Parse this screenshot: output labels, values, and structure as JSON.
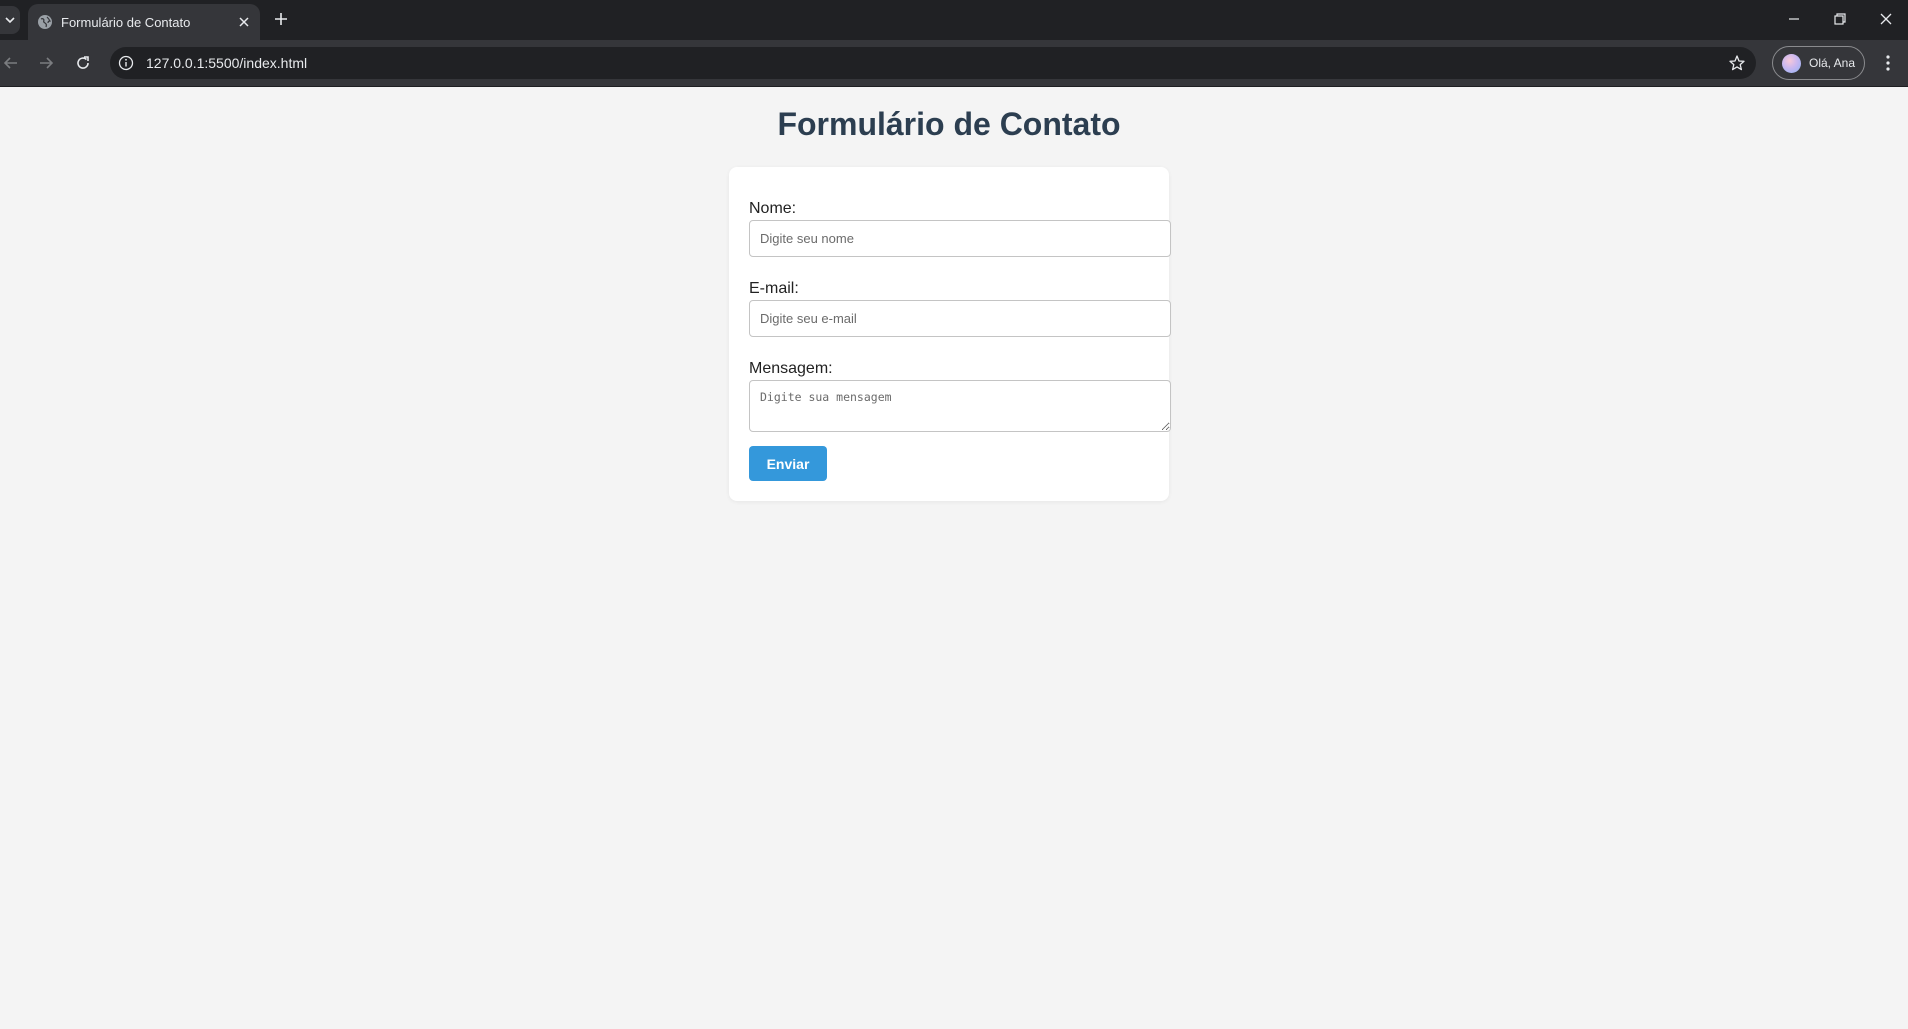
{
  "browser": {
    "tab_title": "Formulário de Contato",
    "url": "127.0.0.1:5500/index.html",
    "profile_label": "Olá, Ana"
  },
  "page": {
    "title": "Formulário de Contato",
    "form": {
      "name_label": "Nome:",
      "name_placeholder": "Digite seu nome",
      "email_label": "E-mail:",
      "email_placeholder": "Digite seu e-mail",
      "message_label": "Mensagem:",
      "message_placeholder": "Digite sua mensagem",
      "submit_label": "Enviar"
    }
  },
  "colors": {
    "title": "#2c3e50",
    "button": "#3498db",
    "page_bg": "#f4f4f4"
  }
}
